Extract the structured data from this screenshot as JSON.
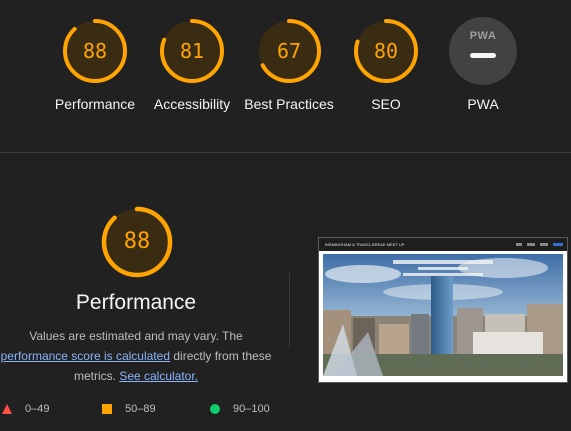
{
  "gauges": [
    {
      "score": "88",
      "label": "Performance",
      "value": 88
    },
    {
      "score": "81",
      "label": "Accessibility",
      "value": 81
    },
    {
      "score": "67",
      "label": "Best Practices",
      "value": 67
    },
    {
      "score": "80",
      "label": "SEO",
      "value": 80
    }
  ],
  "pwa": {
    "badge": "PWA",
    "label": "PWA"
  },
  "performance": {
    "score": "88",
    "value": 88,
    "title": "Performance",
    "desc_pre": "Values are estimated and may vary. The",
    "desc_link1": "performance score is calculated",
    "desc_mid": "directly from these metrics.",
    "desc_link2": "See calculator."
  },
  "screenshot": {
    "site_title": "BIRMINGHAM & TRAVEL BREAK MEET UP"
  },
  "legend": [
    {
      "range": "0–49",
      "shape": "triangle-icon",
      "color": "#ff4e42"
    },
    {
      "range": "50–89",
      "shape": "square-icon",
      "color": "#ffa400"
    },
    {
      "range": "90–100",
      "shape": "circle-icon",
      "color": "#0cce6b"
    }
  ],
  "colors": {
    "average": "#ffa400",
    "track": "#3d2d13",
    "accent_link": "#8ab4f8"
  }
}
